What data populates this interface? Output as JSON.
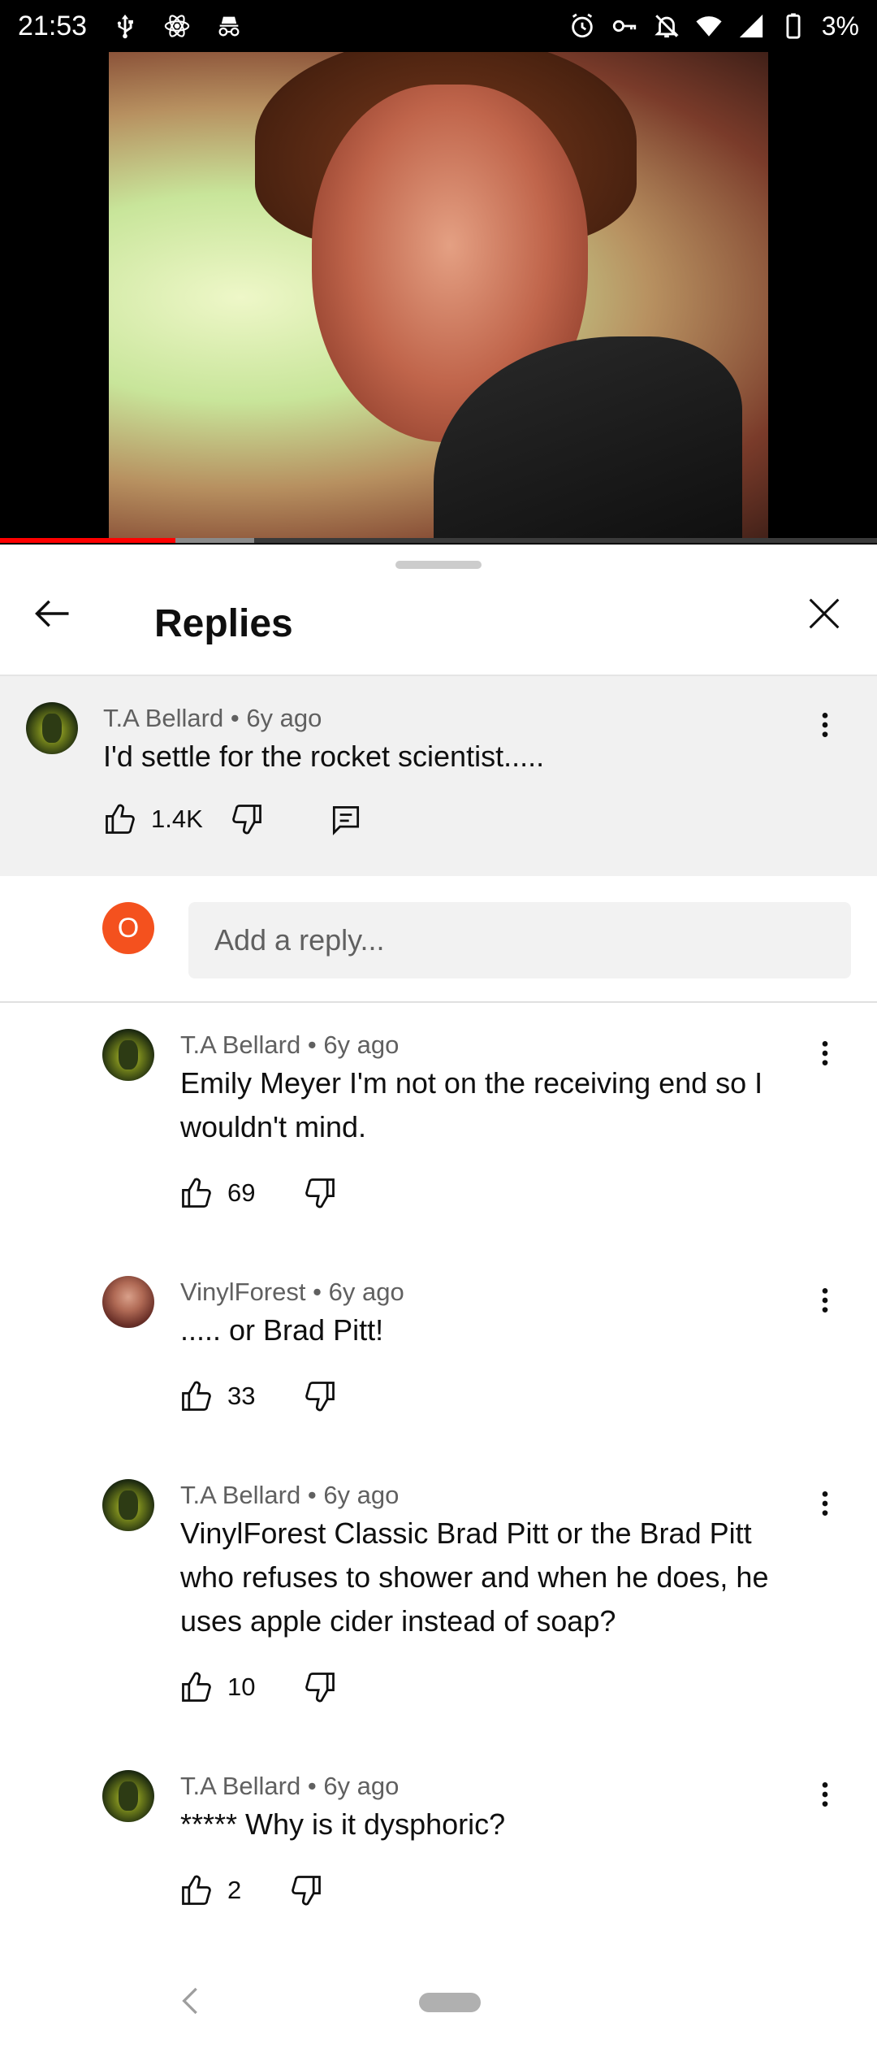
{
  "status_bar": {
    "time": "21:53",
    "battery": "3%",
    "left_icons": [
      "usb-icon",
      "atom-icon",
      "incognito-icon"
    ],
    "right_icons": [
      "alarm-icon",
      "vpn-key-icon",
      "notifications-off-icon",
      "wifi-icon",
      "signal-icon",
      "battery-icon"
    ]
  },
  "video": {
    "progress_fraction": 0.2,
    "buffer_fraction": 0.29
  },
  "sheet": {
    "title": "Replies"
  },
  "parent_comment": {
    "author": "T.A Bellard",
    "age": "6y ago",
    "text": "I'd settle for the rocket scientist.....",
    "likes": "1.4K"
  },
  "add_reply": {
    "avatar_letter": "O",
    "placeholder": "Add a reply..."
  },
  "replies": [
    {
      "author": "T.A Bellard",
      "age": "6y ago",
      "text_line1": "Emily Meyer I'm not on the receiving end so I",
      "text_line2": "wouldn't mind.",
      "likes": "69"
    },
    {
      "author": "VinylForest",
      "age": "6y ago",
      "text_line1": "..... or Brad Pitt!",
      "likes": "33"
    },
    {
      "author": "T.A Bellard",
      "age": "6y ago",
      "text_line1": "VinylForest Classic Brad Pitt or the Brad Pitt",
      "text_line2": "who refuses to shower and when he does, he",
      "text_line3": "uses apple cider instead of soap?",
      "likes": "10"
    },
    {
      "author": "T.A Bellard",
      "age": "6y ago",
      "text_line1": "***** Why is it dysphoric?",
      "likes": "2"
    }
  ],
  "separator": "•",
  "colors": {
    "progress": "#ff0000",
    "self_avatar": "#f4511e",
    "parent_bg": "#f1f1f1"
  }
}
